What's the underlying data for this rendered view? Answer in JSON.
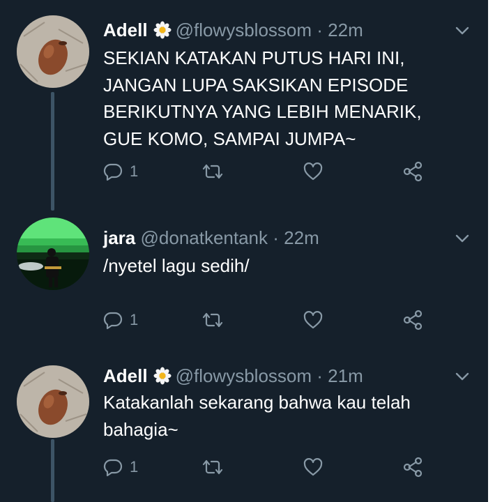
{
  "tweets": [
    {
      "name": "Adell",
      "handle": "@flowysblossom",
      "separator": "·",
      "time": "22m",
      "text": "SEKIAN KATAKAN PUTUS HARI INI,\nJANGAN LUPA SAKSIKAN EPISODE\nBERIKUTNYA YANG LEBIH MENARIK,\nGUE KOMO, SAMPAI JUMPA~",
      "reply_count": "1"
    },
    {
      "name": "jara",
      "handle": "@donatkentank",
      "separator": "·",
      "time": "22m",
      "text": "/nyetel lagu sedih/",
      "reply_count": "1"
    },
    {
      "name": "Adell",
      "handle": "@flowysblossom",
      "separator": "·",
      "time": "21m",
      "text": "Katakanlah sekarang bahwa kau telah\nbahagia~",
      "reply_count": "1"
    }
  ],
  "icons": {
    "badge": "daisy-flower-icon",
    "menu": "chevron-down-icon",
    "reply": "reply-icon",
    "retweet": "retweet-icon",
    "like": "heart-icon",
    "share": "share-icon"
  },
  "colors": {
    "background": "#15202b",
    "text": "#ffffff",
    "secondary": "#8899a6",
    "thread_line": "#3d5466"
  }
}
